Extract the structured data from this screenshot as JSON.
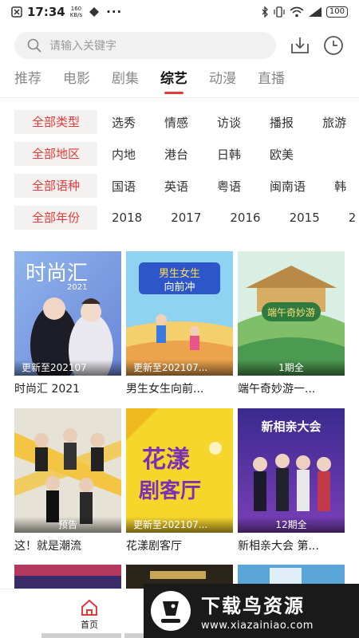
{
  "status": {
    "time": "17:34",
    "speed_value": "160",
    "speed_unit": "KB/s",
    "dots": "···",
    "battery": "100"
  },
  "search": {
    "placeholder": "请输入关键字"
  },
  "tabs": [
    "推荐",
    "电影",
    "剧集",
    "综艺",
    "动漫",
    "直播"
  ],
  "active_tab": "综艺",
  "filters": [
    {
      "label": "全部类型",
      "options": [
        "选秀",
        "情感",
        "访谈",
        "播报",
        "旅游"
      ]
    },
    {
      "label": "全部地区",
      "options": [
        "内地",
        "港台",
        "日韩",
        "欧美"
      ]
    },
    {
      "label": "全部语种",
      "options": [
        "国语",
        "英语",
        "粤语",
        "闽南语",
        "韩"
      ]
    },
    {
      "label": "全部年份",
      "options": [
        "2018",
        "2017",
        "2016",
        "2015",
        "2"
      ]
    }
  ],
  "cards": [
    {
      "title": "时尚汇 2021",
      "badge": "更新至202107",
      "poster_text": "时尚汇",
      "poster_sub": "2021"
    },
    {
      "title": "男生女生向前...",
      "badge": "更新至202107...",
      "poster_text": "男生女生",
      "poster_sub": "向前冲"
    },
    {
      "title": "端午奇妙游一...",
      "badge": "1期全",
      "poster_text": "端午奇妙游",
      "poster_sub": ""
    },
    {
      "title": "这！就是潮流",
      "badge": "预告",
      "poster_text": "",
      "poster_sub": ""
    },
    {
      "title": "花漾剧客厅",
      "badge": "更新至202107...",
      "poster_text": "花漾",
      "poster_sub": "剧客厅"
    },
    {
      "title": "新相亲大会 第...",
      "badge": "12期全",
      "poster_text": "新相亲大会",
      "poster_sub": ""
    }
  ],
  "bottom_nav": {
    "home_label": "首页"
  },
  "watermark": {
    "title": "下载鸟资源",
    "url": "www.xiazainiao.com"
  },
  "colors": {
    "accent": "#e23b3b",
    "chip_bg": "#f4f1f1"
  }
}
